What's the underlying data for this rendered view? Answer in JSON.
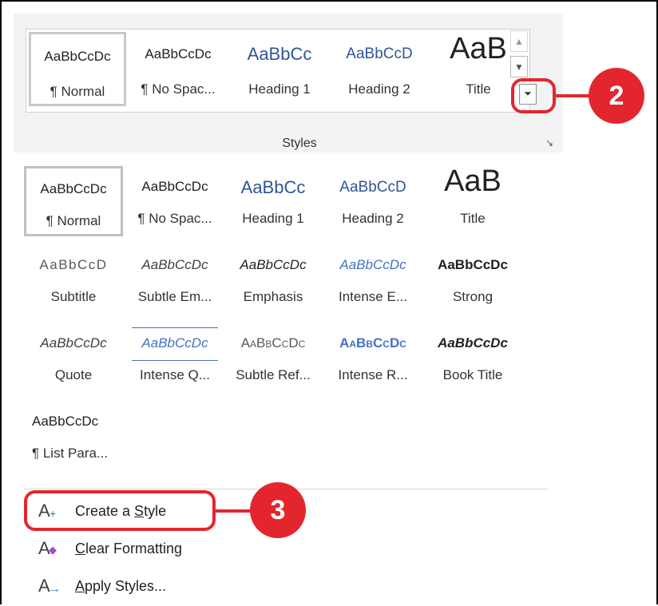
{
  "ribbon": {
    "group_label": "Styles",
    "tiles": [
      {
        "sample": "AaBbCcDc",
        "label": "¶ Normal"
      },
      {
        "sample": "AaBbCcDc",
        "label": "¶ No Spac..."
      },
      {
        "sample": "AaBbCc",
        "label": "Heading 1"
      },
      {
        "sample": "AaBbCcD",
        "label": "Heading 2"
      },
      {
        "sample": "AaB",
        "label": "Title"
      }
    ],
    "scroll_up": "▲",
    "scroll_down": "▼",
    "more": "⏷",
    "launcher": "↘"
  },
  "callouts": {
    "more_button_step": "2",
    "create_style_step": "3"
  },
  "gallery": {
    "rows": [
      [
        {
          "sample": "AaBbCcDc",
          "label": "¶ Normal"
        },
        {
          "sample": "AaBbCcDc",
          "label": "¶ No Spac..."
        },
        {
          "sample": "AaBbCc",
          "label": "Heading 1"
        },
        {
          "sample": "AaBbCcD",
          "label": "Heading 2"
        },
        {
          "sample": "AaB",
          "label": "Title"
        }
      ],
      [
        {
          "sample": "AaBbCcD",
          "label": "Subtitle"
        },
        {
          "sample": "AaBbCcDc",
          "label": "Subtle Em..."
        },
        {
          "sample": "AaBbCcDc",
          "label": "Emphasis"
        },
        {
          "sample": "AaBbCcDc",
          "label": "Intense E..."
        },
        {
          "sample": "AaBbCcDc",
          "label": "Strong"
        }
      ],
      [
        {
          "sample": "AaBbCcDc",
          "label": "Quote"
        },
        {
          "sample": "AaBbCcDc",
          "label": "Intense Q..."
        },
        {
          "sample": "AaBbCcDc",
          "label": "Subtle Ref..."
        },
        {
          "sample": "AaBbCcDc",
          "label": "Intense R..."
        },
        {
          "sample": "AaBbCcDc",
          "label": "Book Title"
        }
      ],
      [
        {
          "sample": "AaBbCcDc",
          "label": "¶ List Para..."
        }
      ]
    ]
  },
  "commands": {
    "create_style": {
      "label_pre": "Create a ",
      "label_ul": "S",
      "label_post": "tyle"
    },
    "clear_formatting": {
      "label_ul": "C",
      "label_post": "lear Formatting"
    },
    "apply_styles": {
      "label_ul": "A",
      "label_post": "pply Styles..."
    }
  },
  "colors": {
    "accent_red": "#e3262e",
    "heading_blue": "#2f5597",
    "intense_blue": "#4472c4"
  }
}
